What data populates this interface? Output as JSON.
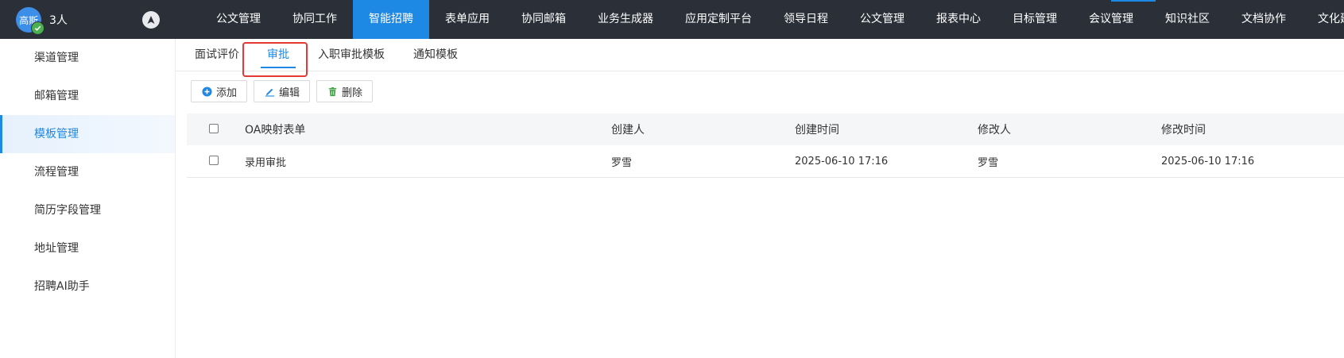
{
  "topbar": {
    "avatar_text": "高斯",
    "user_count": "3人",
    "menu": [
      {
        "label": "公文管理",
        "active": false
      },
      {
        "label": "协同工作",
        "active": false
      },
      {
        "label": "智能招聘",
        "active": true
      },
      {
        "label": "表单应用",
        "active": false
      },
      {
        "label": "协同邮箱",
        "active": false
      },
      {
        "label": "业务生成器",
        "active": false
      },
      {
        "label": "应用定制平台",
        "active": false
      },
      {
        "label": "领导日程",
        "active": false
      },
      {
        "label": "公文管理",
        "active": false
      },
      {
        "label": "报表中心",
        "active": false
      },
      {
        "label": "目标管理",
        "active": false
      },
      {
        "label": "会议管理",
        "active": false
      },
      {
        "label": "知识社区",
        "active": false
      },
      {
        "label": "文档协作",
        "active": false
      },
      {
        "label": "文化建",
        "active": false
      }
    ]
  },
  "sidebar": {
    "items": [
      {
        "label": "渠道管理",
        "active": false
      },
      {
        "label": "邮箱管理",
        "active": false
      },
      {
        "label": "模板管理",
        "active": true
      },
      {
        "label": "流程管理",
        "active": false
      },
      {
        "label": "简历字段管理",
        "active": false
      },
      {
        "label": "地址管理",
        "active": false
      },
      {
        "label": "招聘AI助手",
        "active": false
      }
    ]
  },
  "tabs": [
    {
      "label": "面试评价",
      "active": false
    },
    {
      "label": "审批",
      "active": true
    },
    {
      "label": "入职审批模板",
      "active": false
    },
    {
      "label": "通知模板",
      "active": false
    }
  ],
  "toolbar": {
    "add_label": "添加",
    "edit_label": "编辑",
    "delete_label": "删除"
  },
  "table": {
    "columns": [
      "OA映射表单",
      "创建人",
      "创建时间",
      "修改人",
      "修改时间"
    ],
    "rows": [
      [
        "录用审批",
        "罗雪",
        "2025-06-10 17:16",
        "罗雪",
        "2025-06-10 17:16"
      ]
    ]
  },
  "colors": {
    "topbar_bg": "#2b3038",
    "accent": "#1e88e5",
    "highlight_box": "#e53935"
  }
}
